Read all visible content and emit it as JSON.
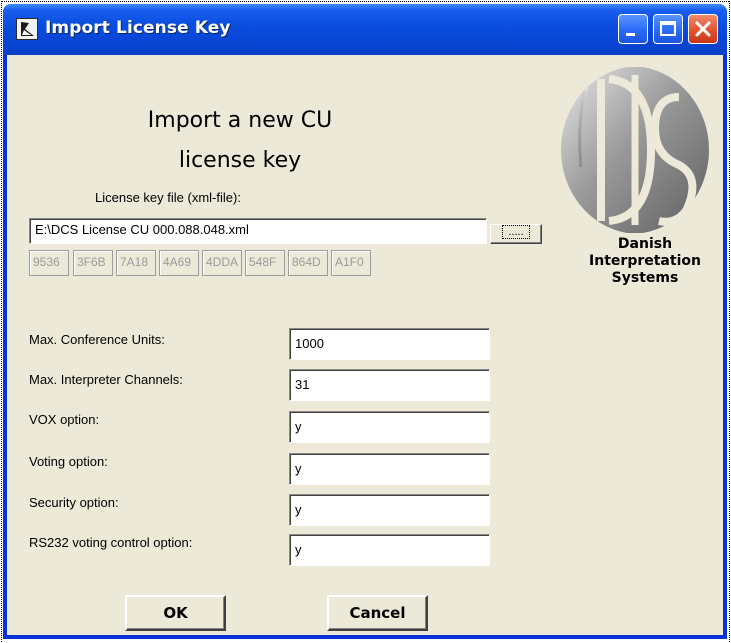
{
  "window": {
    "title": "Import License Key"
  },
  "dialog": {
    "heading_line1": "Import a new CU",
    "heading_line2": "license key",
    "file_label": "License key file (xml-file):",
    "file_value": "E:\\DCS License CU 000.088.048.xml",
    "browse_label": ".....",
    "key_segments": [
      "9536",
      "3F6B",
      "7A18",
      "4A69",
      "4DDA",
      "548F",
      "864D",
      "A1F0"
    ]
  },
  "logo": {
    "mark": "DIS",
    "line1": "Danish",
    "line2": "Interpretation",
    "line3": "Systems"
  },
  "options": [
    {
      "label": "Max. Conference Units:",
      "value": "1000"
    },
    {
      "label": "Max. Interpreter Channels:",
      "value": "31"
    },
    {
      "label": "VOX option:",
      "value": "y"
    },
    {
      "label": "Voting option:",
      "value": "y"
    },
    {
      "label": "Security option:",
      "value": "y"
    },
    {
      "label": "RS232 voting control option:",
      "value": "y"
    }
  ],
  "buttons": {
    "ok": "OK",
    "cancel": "Cancel"
  },
  "colors": {
    "titlebar": "#0a4ee0",
    "dialog_background": "#ece9d8",
    "close_button": "#e2522f"
  },
  "icons": [
    "app-icon",
    "minimize-icon",
    "maximize-icon",
    "close-icon",
    "dis-logo"
  ]
}
